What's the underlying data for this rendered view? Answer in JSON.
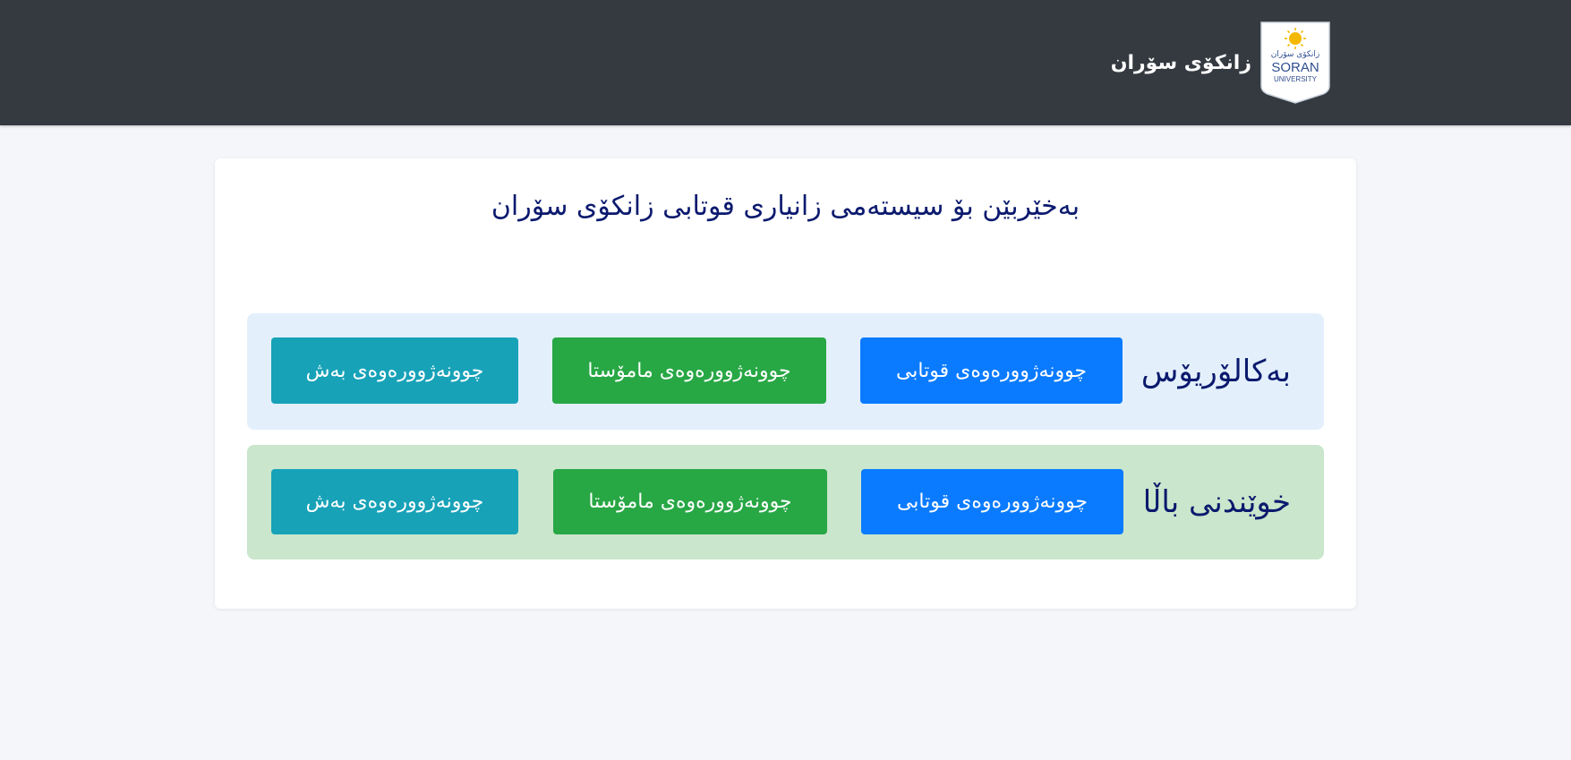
{
  "header": {
    "university_name": "زانکۆی سۆران",
    "logo": {
      "icon": "soran-university-logo-icon",
      "line_kurdish": "زانكۆی سۆران",
      "line_main": "SORAN",
      "line_sub": "UNIVERSITY",
      "sun_color": "#f5b800",
      "text_color": "#2f4f8f"
    }
  },
  "main": {
    "welcome": "بەخێربێن بۆ سیستەمی زانیاری قوتابی زانکۆی سۆران",
    "sections": [
      {
        "title": "بەکالۆریۆس",
        "student_button": "چوونەژوورەوەی قوتابی",
        "teacher_button": "چوونەژوورەوەی مامۆستا",
        "department_button": "چوونەژوورەوەی بەش"
      },
      {
        "title": "خوێندنی باڵا",
        "student_button": "چوونەژوورەوەی قوتابی",
        "teacher_button": "چوونەژوورەوەی مامۆستا",
        "department_button": "چوونەژوورەوەی بەش"
      }
    ]
  },
  "colors": {
    "header_bg": "#343a40",
    "page_bg": "#f4f6f9",
    "student_button": "#0a7bff",
    "teacher_button": "#28a745",
    "department_button": "#17a2b8",
    "bachelor_row_bg": "#e3f0fc",
    "higher_row_bg": "#cae6cc",
    "title_text": "#0b1a6e"
  }
}
